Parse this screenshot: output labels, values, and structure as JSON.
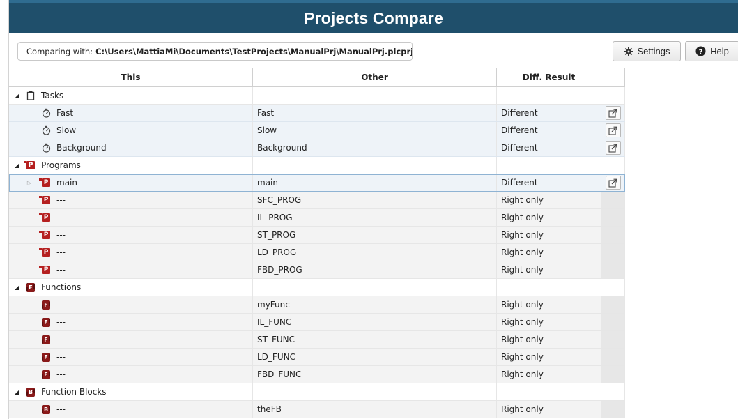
{
  "window": {
    "title": "Projects Compare"
  },
  "toolbar": {
    "comparing_label": "Comparing with:",
    "comparing_path": "C:\\Users\\MattiaMi\\Documents\\TestProjects\\ManualPrj\\ManualPrj.plcprj",
    "settings_label": "Settings",
    "help_label": "Help"
  },
  "table": {
    "headers": [
      "This",
      "Other",
      "Diff. Result",
      ""
    ],
    "rows": [
      {
        "kind": "group",
        "this": "Tasks",
        "icon": "clipboard-icon",
        "other": "",
        "result": ""
      },
      {
        "kind": "item",
        "this": "Fast",
        "icon": "stopwatch-icon",
        "other": "Fast",
        "result": "Different",
        "button": true
      },
      {
        "kind": "item",
        "this": "Slow",
        "icon": "stopwatch-icon",
        "other": "Slow",
        "result": "Different",
        "button": true
      },
      {
        "kind": "item",
        "this": "Background",
        "icon": "stopwatch-icon",
        "other": "Background",
        "result": "Different",
        "button": true
      },
      {
        "kind": "group",
        "this": "Programs",
        "icon": "program-icon",
        "other": "",
        "result": ""
      },
      {
        "kind": "item",
        "this": "main",
        "icon": "program-icon",
        "other": "main",
        "result": "Different",
        "button": true,
        "expandable": true,
        "selected": true
      },
      {
        "kind": "right",
        "this": "---",
        "icon": "program-icon",
        "other": "SFC_PROG",
        "result": "Right only"
      },
      {
        "kind": "right",
        "this": "---",
        "icon": "program-icon",
        "other": "IL_PROG",
        "result": "Right only"
      },
      {
        "kind": "right",
        "this": "---",
        "icon": "program-icon",
        "other": "ST_PROG",
        "result": "Right only"
      },
      {
        "kind": "right",
        "this": "---",
        "icon": "program-icon",
        "other": "LD_PROG",
        "result": "Right only"
      },
      {
        "kind": "right",
        "this": "---",
        "icon": "program-icon",
        "other": "FBD_PROG",
        "result": "Right only"
      },
      {
        "kind": "group",
        "this": "Functions",
        "icon": "function-icon",
        "other": "",
        "result": ""
      },
      {
        "kind": "right",
        "this": "---",
        "icon": "function-icon",
        "other": "myFunc",
        "result": "Right only"
      },
      {
        "kind": "right",
        "this": "---",
        "icon": "function-icon",
        "other": "IL_FUNC",
        "result": "Right only"
      },
      {
        "kind": "right",
        "this": "---",
        "icon": "function-icon",
        "other": "ST_FUNC",
        "result": "Right only"
      },
      {
        "kind": "right",
        "this": "---",
        "icon": "function-icon",
        "other": "LD_FUNC",
        "result": "Right only"
      },
      {
        "kind": "right",
        "this": "---",
        "icon": "function-icon",
        "other": "FBD_FUNC",
        "result": "Right only"
      },
      {
        "kind": "group",
        "this": "Function Blocks",
        "icon": "function-block-icon",
        "other": "",
        "result": ""
      },
      {
        "kind": "right",
        "this": "---",
        "icon": "function-block-icon",
        "other": "theFB",
        "result": "Right only"
      }
    ]
  },
  "colors": {
    "titlebar": "#1f4f6b",
    "icon_red": "#b52020",
    "diff_row": "#eef3f8",
    "right_only_row": "#f3f3f3"
  }
}
